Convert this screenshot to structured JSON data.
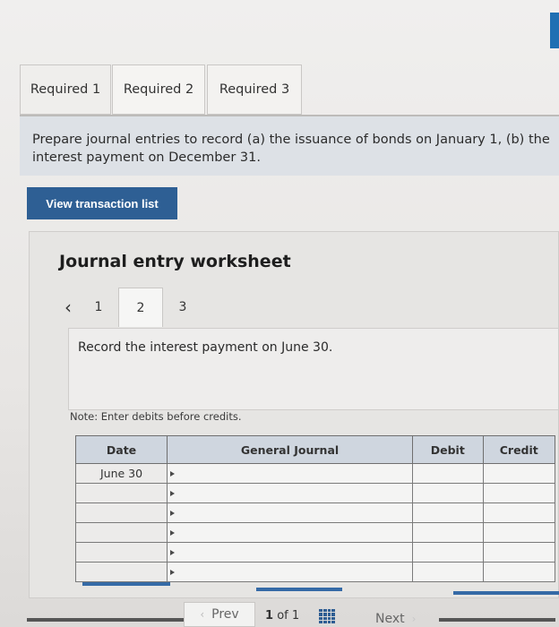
{
  "tabs": [
    {
      "label": "Required 1"
    },
    {
      "label": "Required 2"
    },
    {
      "label": "Required 3"
    }
  ],
  "instruction": {
    "line1": "Prepare journal entries to record (a) the issuance of bonds on January 1, (b) the",
    "line2": "interest payment on December 31."
  },
  "view_transaction_button": "View transaction list",
  "worksheet": {
    "title": "Journal entry worksheet",
    "pager": {
      "prev_icon": "chevron-left-icon",
      "steps": [
        "1",
        "2",
        "3"
      ],
      "active_step": "2"
    },
    "step_text": "Record the interest payment on June 30.",
    "note": "Note: Enter debits before credits."
  },
  "table": {
    "headers": {
      "date": "Date",
      "general_journal": "General Journal",
      "debit": "Debit",
      "credit": "Credit"
    },
    "first_date": "June 30"
  },
  "footer": {
    "prev_label": "Prev",
    "page_current": "1",
    "page_of": "of",
    "page_total": "1",
    "next_label": "Next",
    "grid_icon": "grid-icon"
  },
  "colors": {
    "accent": "#2e5f94",
    "header_bg": "#cfd6df"
  }
}
